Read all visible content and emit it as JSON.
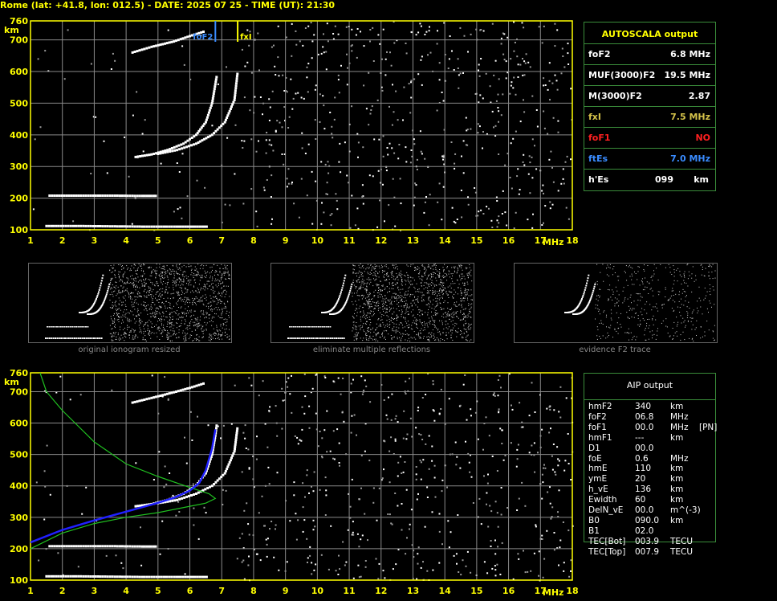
{
  "header": {
    "title": "Rome (lat: +41.8, lon: 012.5) - DATE: 2025 07 25 - TIME (UT): 21:30"
  },
  "autoscala": {
    "title": "AUTOSCALA output",
    "rows": [
      {
        "key": "foF2",
        "value": "6.8 MHz",
        "color": "#ffffff"
      },
      {
        "key": "MUF(3000)F2",
        "value": "19.5 MHz",
        "color": "#ffffff"
      },
      {
        "key": "M(3000)F2",
        "value": "2.87",
        "color": "#ffffff"
      },
      {
        "key": "fxI",
        "value": "7.5 MHz",
        "color": "#d4c24a"
      },
      {
        "key": "foF1",
        "value": "NO",
        "color": "#ff2020"
      },
      {
        "key": "ftEs",
        "value": "7.0 MHz",
        "color": "#3a8cff"
      },
      {
        "key": "h'Es",
        "value": "099",
        "unit": "km",
        "color": "#ffffff"
      }
    ]
  },
  "aip": {
    "title": "AIP output",
    "rows": [
      {
        "key": "hmF2",
        "value": "340",
        "unit": "km",
        "extra": ""
      },
      {
        "key": "foF2",
        "value": "06.8",
        "unit": "MHz",
        "extra": ""
      },
      {
        "key": "foF1",
        "value": "00.0",
        "unit": "MHz",
        "extra": "[PN]"
      },
      {
        "key": "hmF1",
        "value": "---",
        "unit": "km",
        "extra": ""
      },
      {
        "key": "D1",
        "value": "00.0",
        "unit": "",
        "extra": ""
      },
      {
        "key": "foE",
        "value": "0.6",
        "unit": "MHz",
        "extra": ""
      },
      {
        "key": "hmE",
        "value": "110",
        "unit": "km",
        "extra": ""
      },
      {
        "key": "ymE",
        "value": "20",
        "unit": "km",
        "extra": ""
      },
      {
        "key": "h_vE",
        "value": "136",
        "unit": "km",
        "extra": ""
      },
      {
        "key": "Ewidth",
        "value": "60",
        "unit": "km",
        "extra": ""
      },
      {
        "key": "DelN_vE",
        "value": "00.0",
        "unit": "m^(-3)",
        "extra": ""
      },
      {
        "key": "B0",
        "value": "090.0",
        "unit": "km",
        "extra": ""
      },
      {
        "key": "B1",
        "value": "02.0",
        "unit": "",
        "extra": ""
      },
      {
        "key": "TEC[Bot]",
        "value": "003.9",
        "unit": "TECU",
        "extra": ""
      },
      {
        "key": "TEC[Top]",
        "value": "007.9",
        "unit": "TECU",
        "extra": ""
      }
    ]
  },
  "thumbnails": [
    {
      "caption": "original ionogram resized"
    },
    {
      "caption": "eliminate multiple reflections"
    },
    {
      "caption": "evidence F2 trace"
    }
  ],
  "chart_data": [
    {
      "type": "scatter",
      "name_hint": "top ionogram",
      "xlabel": "MHz",
      "ylabel": "km",
      "xlim": [
        1,
        18
      ],
      "ylim": [
        100,
        760
      ],
      "xticks": [
        1,
        2,
        3,
        4,
        5,
        6,
        7,
        8,
        9,
        10,
        11,
        12,
        13,
        14,
        15,
        16,
        17,
        18
      ],
      "yticks": [
        100,
        200,
        300,
        400,
        500,
        600,
        700,
        760
      ],
      "markers": [
        {
          "label": "foF2",
          "x": 6.8,
          "color": "#3a8cff"
        },
        {
          "label": "fxI",
          "x": 7.5,
          "color": "#ffff00"
        }
      ],
      "traces": [
        {
          "name": "o-trace",
          "color": "#ffffff",
          "points": [
            [
              4.3,
              330
            ],
            [
              4.8,
              338
            ],
            [
              5.3,
              352
            ],
            [
              5.8,
              372
            ],
            [
              6.2,
              400
            ],
            [
              6.5,
              440
            ],
            [
              6.7,
              500
            ],
            [
              6.8,
              560
            ],
            [
              6.85,
              590
            ]
          ]
        },
        {
          "name": "x-trace",
          "color": "#ffffff",
          "points": [
            [
              5.0,
              340
            ],
            [
              5.6,
              352
            ],
            [
              6.2,
              372
            ],
            [
              6.7,
              400
            ],
            [
              7.1,
              440
            ],
            [
              7.4,
              510
            ],
            [
              7.5,
              600
            ]
          ]
        },
        {
          "name": "Es layer",
          "color": "#ffffff",
          "points": [
            [
              1.5,
              112
            ],
            [
              2.5,
              112
            ],
            [
              3.5,
              111
            ],
            [
              4.5,
              110
            ],
            [
              5.5,
              110
            ],
            [
              6.6,
              110
            ]
          ]
        },
        {
          "name": "Es multiple",
          "color": "#ffffff",
          "points": [
            [
              1.6,
              208
            ],
            [
              2.5,
              208
            ],
            [
              3.5,
              208
            ],
            [
              4.5,
              207
            ],
            [
              5.0,
              207
            ]
          ]
        },
        {
          "name": "second hop",
          "color": "#ffffff",
          "points": [
            [
              4.2,
              660
            ],
            [
              4.8,
              678
            ],
            [
              5.5,
              695
            ],
            [
              6.0,
              712
            ],
            [
              6.5,
              728
            ]
          ]
        }
      ]
    },
    {
      "type": "line",
      "name_hint": "bottom ionogram with AIP profile",
      "xlabel": "MHz",
      "ylabel": "km",
      "xlim": [
        1,
        18
      ],
      "ylim": [
        100,
        760
      ],
      "xticks": [
        1,
        2,
        3,
        4,
        5,
        6,
        7,
        8,
        9,
        10,
        11,
        12,
        13,
        14,
        15,
        16,
        17,
        18
      ],
      "yticks": [
        100,
        200,
        300,
        400,
        500,
        600,
        700,
        760
      ],
      "series": [
        {
          "name": "profile",
          "color": "#20c020",
          "points": [
            [
              1.0,
              200
            ],
            [
              2.0,
              250
            ],
            [
              3.0,
              280
            ],
            [
              4.0,
              300
            ],
            [
              5.0,
              315
            ],
            [
              6.0,
              335
            ],
            [
              6.5,
              345
            ],
            [
              6.8,
              360
            ],
            [
              6.6,
              375
            ],
            [
              6.0,
              395
            ],
            [
              5.0,
              430
            ],
            [
              4.0,
              470
            ],
            [
              3.0,
              540
            ],
            [
              2.0,
              640
            ],
            [
              1.5,
              700
            ],
            [
              1.3,
              760
            ]
          ]
        },
        {
          "name": "fitted trace",
          "color": "#2020ff",
          "points": [
            [
              1.0,
              220
            ],
            [
              2.0,
              260
            ],
            [
              3.0,
              290
            ],
            [
              4.0,
              318
            ],
            [
              4.5,
              332
            ],
            [
              5.0,
              346
            ],
            [
              5.5,
              362
            ],
            [
              6.0,
              385
            ],
            [
              6.3,
              410
            ],
            [
              6.5,
              450
            ],
            [
              6.7,
              520
            ],
            [
              6.8,
              580
            ]
          ]
        },
        {
          "name": "o-trace",
          "color": "#ffffff",
          "points": [
            [
              4.3,
              335
            ],
            [
              4.8,
              342
            ],
            [
              5.3,
              355
            ],
            [
              5.8,
              375
            ],
            [
              6.2,
              402
            ],
            [
              6.5,
              440
            ],
            [
              6.7,
              500
            ],
            [
              6.8,
              560
            ],
            [
              6.85,
              600
            ]
          ]
        },
        {
          "name": "x-trace",
          "color": "#ffffff",
          "points": [
            [
              5.0,
              345
            ],
            [
              5.6,
              355
            ],
            [
              6.2,
              375
            ],
            [
              6.7,
              400
            ],
            [
              7.1,
              440
            ],
            [
              7.4,
              510
            ],
            [
              7.5,
              590
            ]
          ]
        },
        {
          "name": "Es layer",
          "color": "#ffffff",
          "points": [
            [
              1.5,
              112
            ],
            [
              2.5,
              112
            ],
            [
              3.5,
              111
            ],
            [
              4.5,
              110
            ],
            [
              5.5,
              110
            ],
            [
              6.6,
              110
            ]
          ]
        },
        {
          "name": "Es multiple",
          "color": "#ffffff",
          "points": [
            [
              1.6,
              208
            ],
            [
              2.5,
              208
            ],
            [
              3.5,
              208
            ],
            [
              4.5,
              207
            ],
            [
              5.0,
              207
            ]
          ]
        },
        {
          "name": "second hop",
          "color": "#ffffff",
          "points": [
            [
              4.2,
              665
            ],
            [
              4.8,
              680
            ],
            [
              5.5,
              698
            ],
            [
              6.0,
              712
            ],
            [
              6.5,
              728
            ]
          ]
        }
      ]
    }
  ]
}
